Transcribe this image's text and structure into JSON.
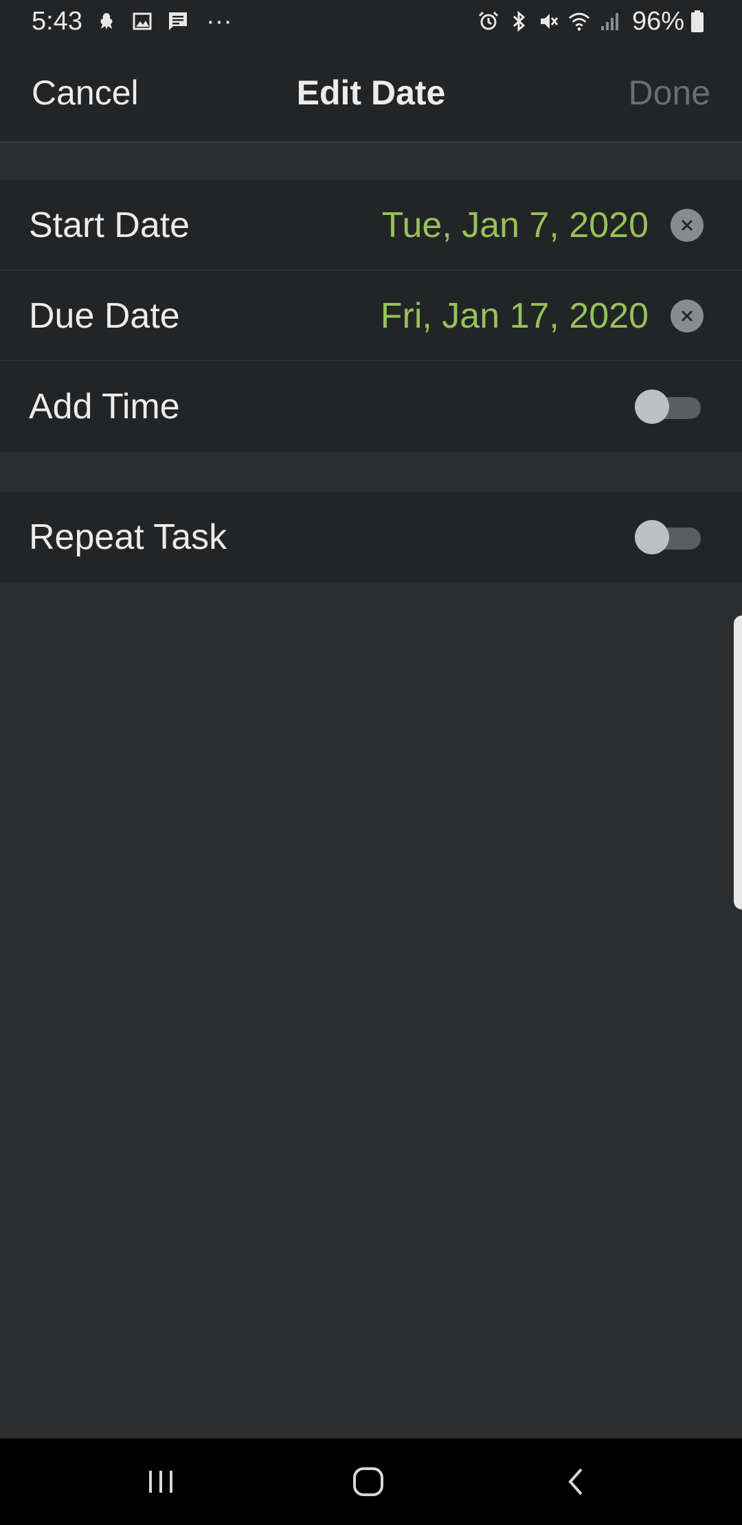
{
  "status_bar": {
    "time": "5:43",
    "overflow": "···",
    "battery": "96%",
    "left_icons": [
      "notification-icon",
      "gallery-icon",
      "message-icon"
    ],
    "right_icons": [
      "alarm-icon",
      "bluetooth-icon",
      "mute-icon",
      "wifi-icon",
      "signal-icon",
      "battery-icon"
    ]
  },
  "header": {
    "cancel_label": "Cancel",
    "title": "Edit Date",
    "done_label": "Done"
  },
  "date_group": {
    "start_date": {
      "label": "Start Date",
      "value": "Tue, Jan 7, 2020"
    },
    "due_date": {
      "label": "Due Date",
      "value": "Fri, Jan 17, 2020"
    },
    "add_time": {
      "label": "Add Time",
      "enabled": false
    }
  },
  "repeat_group": {
    "repeat_task": {
      "label": "Repeat Task",
      "enabled": false
    }
  },
  "colors": {
    "accent_date": "#95c25a",
    "background": "#2c2d2f",
    "surface": "#232426",
    "disabled_text": "#6c6d70"
  },
  "nav_bar": {
    "icons": [
      "recents-icon",
      "home-icon",
      "back-icon"
    ]
  }
}
